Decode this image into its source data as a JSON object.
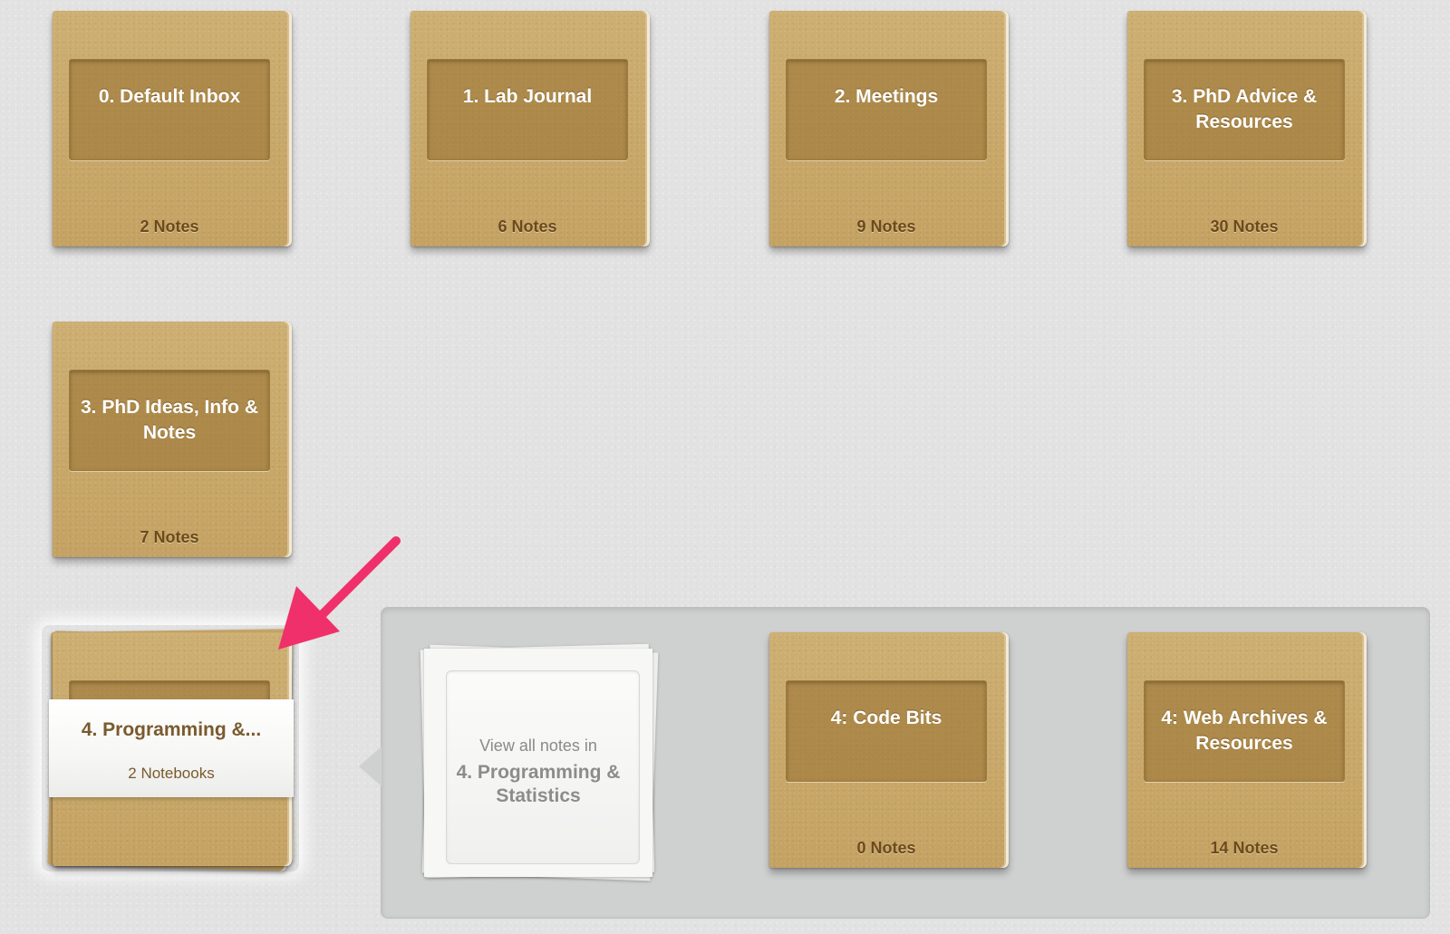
{
  "notebooks": [
    {
      "title": "0. Default Inbox",
      "count": "2 Notes"
    },
    {
      "title": "1. Lab Journal",
      "count": "6 Notes"
    },
    {
      "title": "2. Meetings",
      "count": "9 Notes"
    },
    {
      "title": "3. PhD Advice & Resources",
      "count": "30 Notes"
    },
    {
      "title": "3. PhD Ideas, Info & Notes",
      "count": "7 Notes"
    }
  ],
  "stack": {
    "title": "4. Programming &...",
    "count": "2 Notebooks"
  },
  "expanded": {
    "view_all_line1": "View all notes in",
    "view_all_line2": "4. Programming & Statistics",
    "notebooks": [
      {
        "title": "4: Code Bits",
        "count": "0 Notes"
      },
      {
        "title": "4: Web Archives & Resources",
        "count": "14 Notes"
      }
    ]
  },
  "annotation": {
    "arrow_color": "#f0306a"
  }
}
